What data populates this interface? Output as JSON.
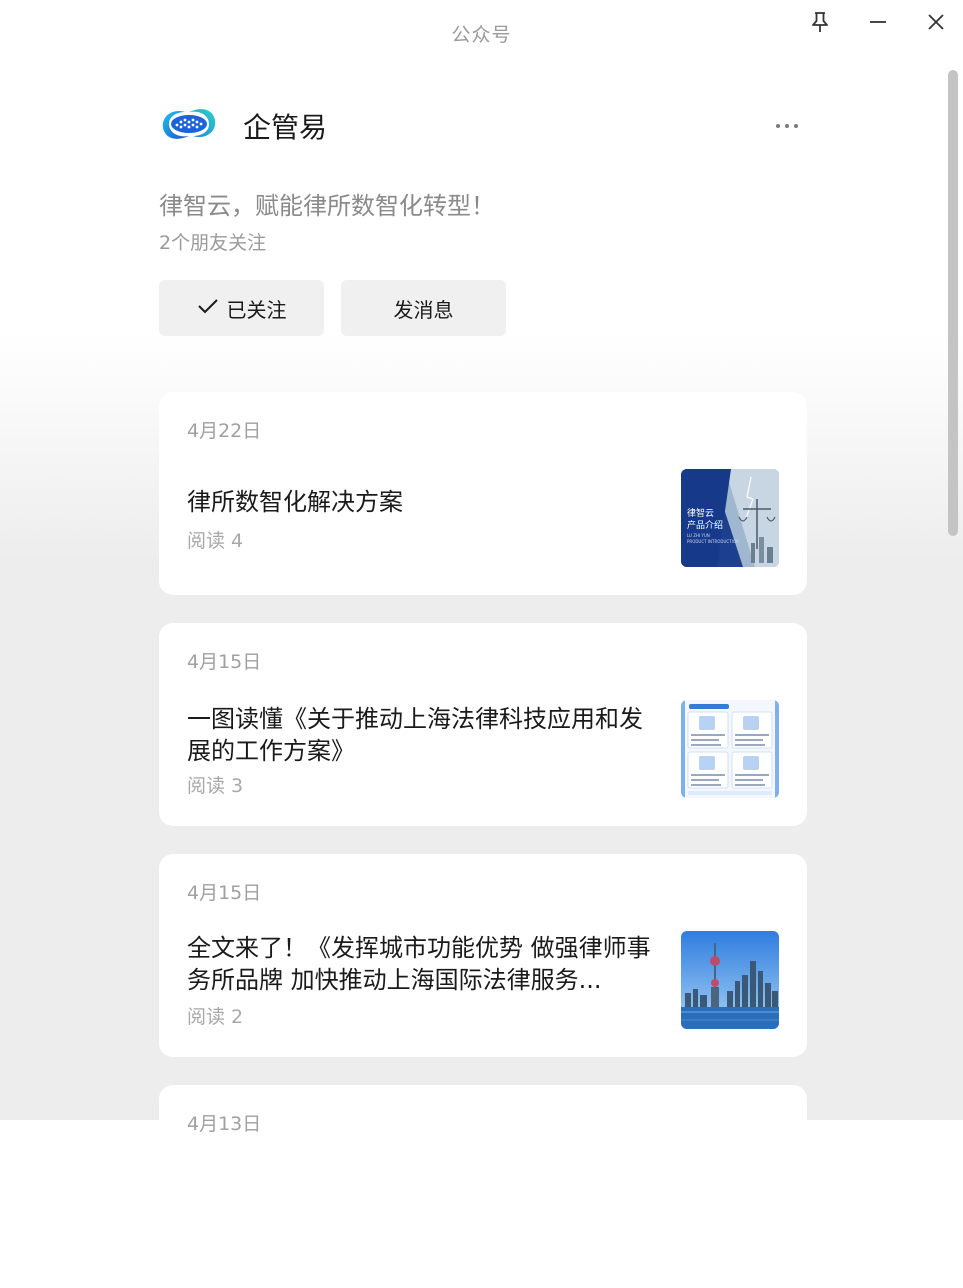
{
  "window": {
    "title": "公众号",
    "controls": [
      "pin-icon",
      "minimize-icon",
      "close-icon"
    ]
  },
  "profile": {
    "name": "企管易",
    "bio": "律智云，赋能律所数智化转型！",
    "followers": "2个朋友关注",
    "followed_label": "已关注",
    "message_label": "发消息",
    "more_icon": "more-dots-icon"
  },
  "articles": [
    {
      "date": "4月22日",
      "title": "律所数智化解决方案",
      "reads": "阅读 4",
      "thumb_text_1": "律智云",
      "thumb_text_2": "产品介绍",
      "thumb_text_3": "LU ZHI YUN",
      "thumb_text_4": "PRODUCT INTRODUCTION"
    },
    {
      "date": "4月15日",
      "title": "一图读懂《关于推动上海法律科技应用和发展的工作方案》",
      "reads": "阅读 3"
    },
    {
      "date": "4月15日",
      "title": "全文来了！《发挥城市功能优势 做强律师事务所品牌 加快推动上海国际法律服务...",
      "reads": "阅读 2"
    },
    {
      "date": "4月13日",
      "title": "",
      "reads": ""
    }
  ],
  "colors": {
    "accent_blue": "#1e63c8",
    "card_bg": "#ffffff",
    "page_bg": "#ededed",
    "button_bg": "#f0f0f0"
  }
}
